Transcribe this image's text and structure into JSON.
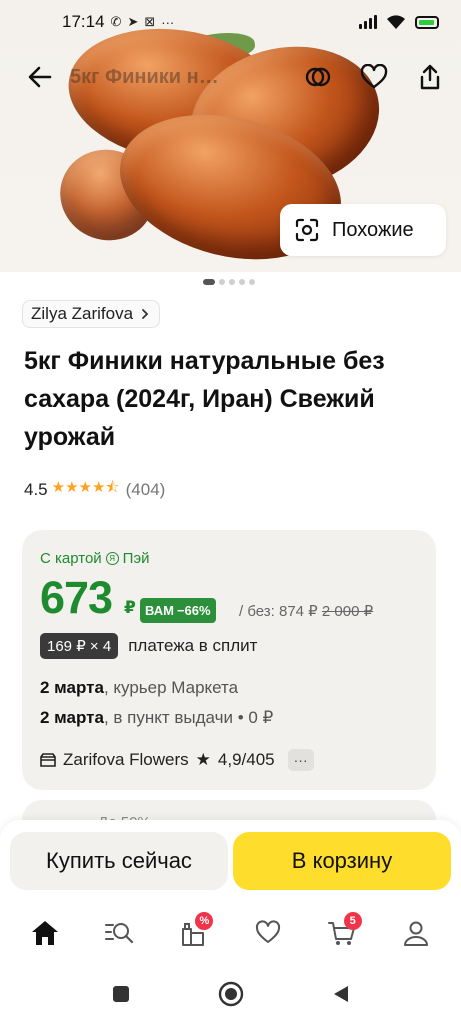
{
  "status_bar": {
    "time": "17:14"
  },
  "header": {
    "title": "5кг Финики н…"
  },
  "gallery": {
    "similar_label": "Похожие",
    "slides_total": 5,
    "active_slide": 1
  },
  "seller_chip": {
    "name": "Zilya Zarifova"
  },
  "product": {
    "title": "5кг Финики натуральные без сахара (2024г, Иран) Свежий урожай",
    "rating": "4.5",
    "rating_stars": 4.5,
    "reviews_count": "(404)"
  },
  "price_card": {
    "card_label": "С картой",
    "card_brand": "Пэй",
    "price": "673",
    "currency": "₽",
    "discount_label": "ВАМ",
    "discount": "−66%",
    "old_price_prefix": "/ без: 874 ₽",
    "old_price": "2 000 ₽",
    "split_amount": "169 ₽ × 4",
    "split_label": "платежа в сплит",
    "delivery": [
      {
        "date": "2 марта",
        "text": ", курьер Маркета"
      },
      {
        "date": "2 марта",
        "text": ", в пункт выдачи • 0 ₽"
      }
    ],
    "seller_name": "Zarifova Flowers",
    "seller_rating": "4,9",
    "seller_reviews": "/405",
    "more": "···"
  },
  "peek": {
    "text": "До 50%"
  },
  "buy_bar": {
    "buy_now": "Купить сейчас",
    "add_to_cart": "В корзину"
  },
  "tabbar": {
    "deals_badge": "%",
    "cart_badge": "5"
  },
  "colors": {
    "accent_green": "#1e8b2f",
    "cart_yellow": "#ffdd2d",
    "badge_red": "#f0354b",
    "star_orange": "#ffa21f"
  }
}
